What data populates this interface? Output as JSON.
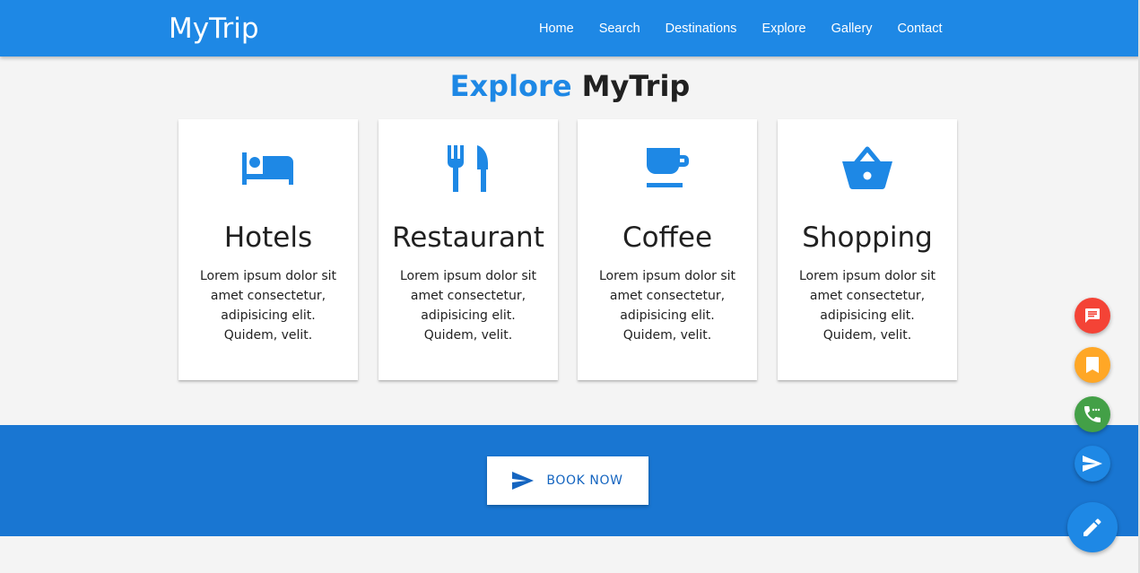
{
  "brand": "MyTrip",
  "nav": [
    "Home",
    "Search",
    "Destinations",
    "Explore",
    "Gallery",
    "Contact"
  ],
  "heading": {
    "accent": "Explore",
    "rest": "MyTrip"
  },
  "cards": [
    {
      "icon": "bed-icon",
      "title": "Hotels",
      "text": "Lorem ipsum dolor sit amet consectetur, adipisicing elit. Quidem, velit."
    },
    {
      "icon": "restaurant-icon",
      "title": "Restaurant",
      "text": "Lorem ipsum dolor sit amet consectetur, adipisicing elit. Quidem, velit."
    },
    {
      "icon": "coffee-icon",
      "title": "Coffee",
      "text": "Lorem ipsum dolor sit amet consectetur, adipisicing elit. Quidem, velit."
    },
    {
      "icon": "shopping-basket-icon",
      "title": "Shopping",
      "text": "Lorem ipsum dolor sit amet consectetur, adipisicing elit. Quidem, velit."
    }
  ],
  "cta": {
    "label": "BOOK NOW",
    "icon": "send-icon"
  },
  "fabs": [
    {
      "icon": "message-icon",
      "color": "#f44336"
    },
    {
      "icon": "bookmark-icon",
      "color": "#ffa726"
    },
    {
      "icon": "phone-icon",
      "color": "#43a047"
    },
    {
      "icon": "send-icon",
      "color": "#1e88e5"
    }
  ],
  "main_fab": {
    "icon": "edit-icon",
    "color": "#1e88e5"
  },
  "colors": {
    "primary": "#1e88e5",
    "band": "#1976d2",
    "background": "#f4f4f4"
  }
}
